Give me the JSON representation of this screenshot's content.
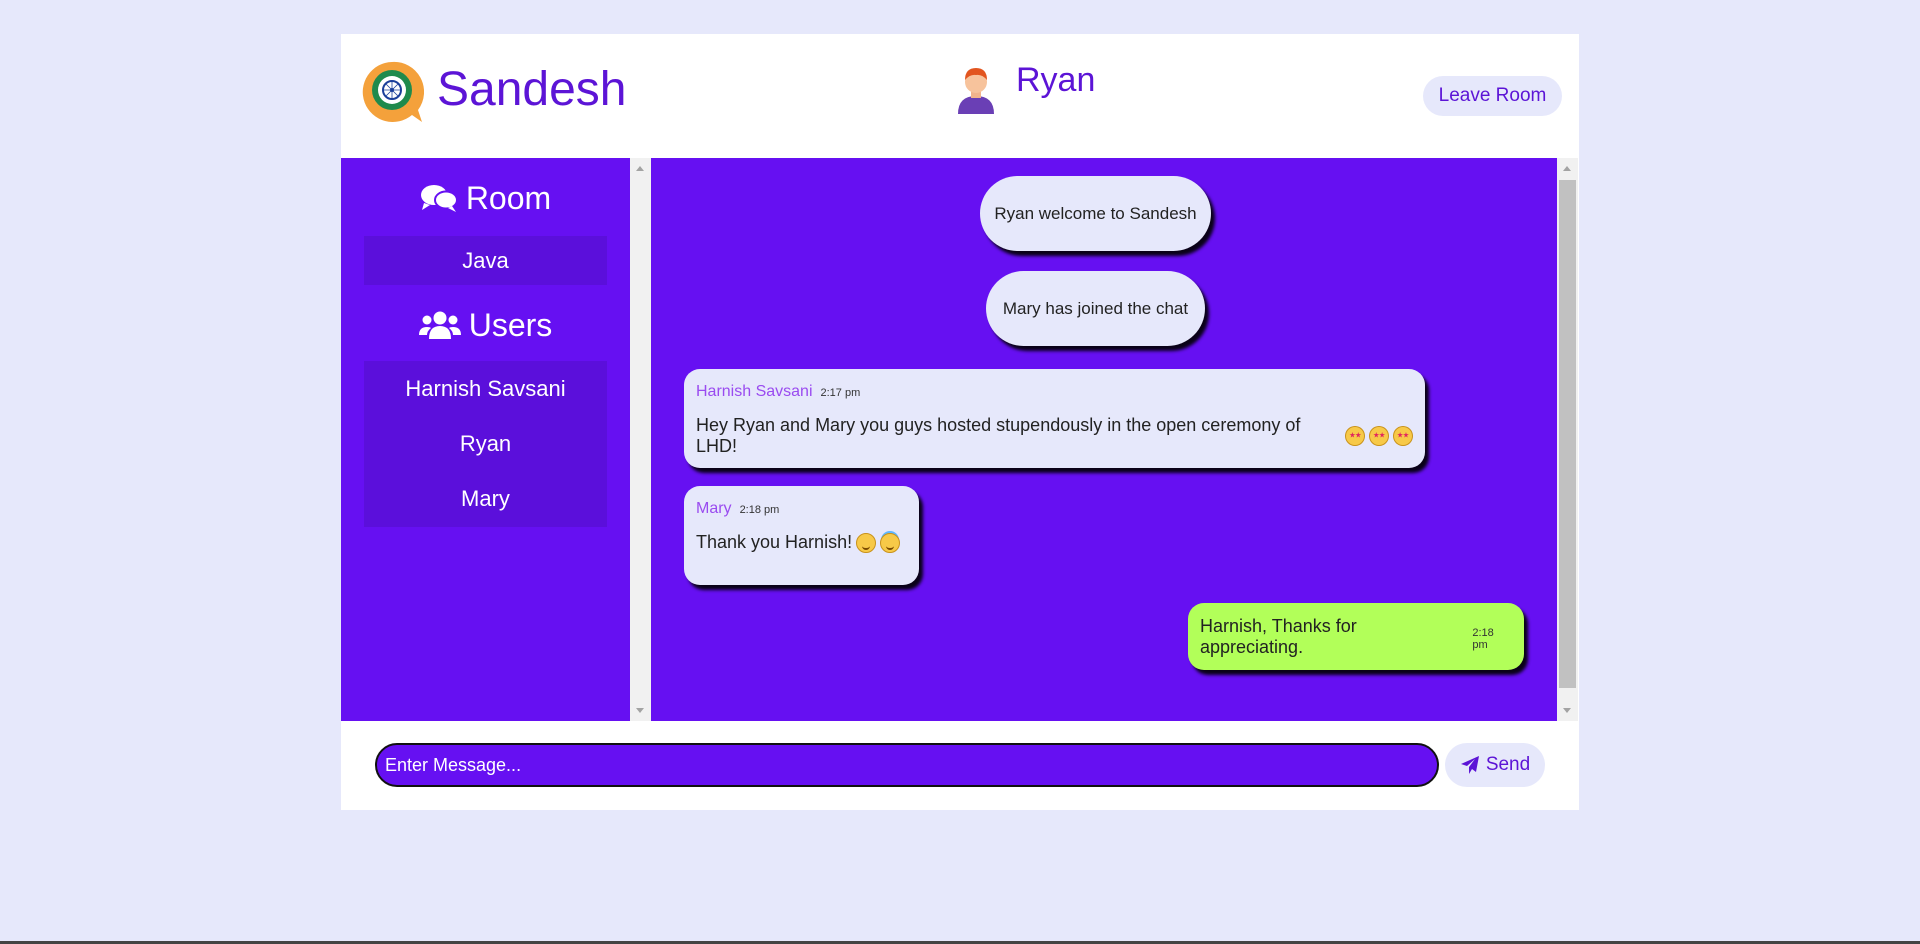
{
  "header": {
    "brand": "Sandesh",
    "current_user": "Ryan",
    "leave_label": "Leave Room"
  },
  "sidebar": {
    "room_title": "Room",
    "room_name": "Java",
    "users_title": "Users",
    "users": [
      "Harnish Savsani",
      "Ryan",
      "Mary"
    ]
  },
  "messages": {
    "system": [
      "Ryan welcome to Sandesh",
      "Mary has joined the chat"
    ],
    "incoming": [
      {
        "sender": "Harnish Savsani",
        "time": "2:17 pm",
        "text": "Hey Ryan and Mary you guys hosted stupendously in the open ceremony of LHD!"
      },
      {
        "sender": "Mary",
        "time": "2:18 pm",
        "text": "Thank you Harnish!"
      }
    ],
    "outgoing": [
      {
        "time": "2:18 pm",
        "text": "Harnish, Thanks for appreciating."
      }
    ]
  },
  "composer": {
    "placeholder": "Enter Message...",
    "send_label": "Send"
  },
  "colors": {
    "accent": "#6610f2",
    "brand_text": "#5c14d6",
    "background": "#e6e8fb",
    "own_bubble": "#b2ff59"
  },
  "icons": [
    "app-logo-icon",
    "user-avatar-icon",
    "comments-icon",
    "users-icon",
    "paper-plane-icon",
    "star-eyes-emoji",
    "smile-emoji",
    "halo-emoji"
  ]
}
